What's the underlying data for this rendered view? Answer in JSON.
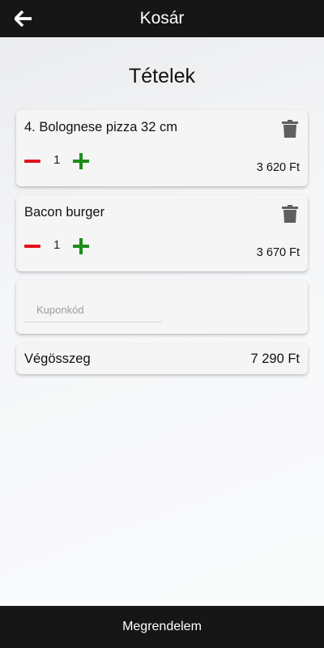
{
  "header": {
    "title": "Kosár",
    "back_icon": "arrow-left-icon"
  },
  "page_title": "Tételek",
  "items": [
    {
      "name": "4. Bolognese pizza 32 cm",
      "quantity": "1",
      "price": "3 620 Ft"
    },
    {
      "name": "Bacon burger",
      "quantity": "1",
      "price": "3 670 Ft"
    }
  ],
  "coupon": {
    "placeholder": "Kuponkód",
    "value": ""
  },
  "total": {
    "label": "Végösszeg",
    "value": "7 290 Ft"
  },
  "footer": {
    "order_button": "Megrendelem"
  },
  "colors": {
    "bar": "#161616",
    "minus": "#e1131a",
    "plus": "#1e8c1e",
    "trash": "#5f5f5f"
  }
}
